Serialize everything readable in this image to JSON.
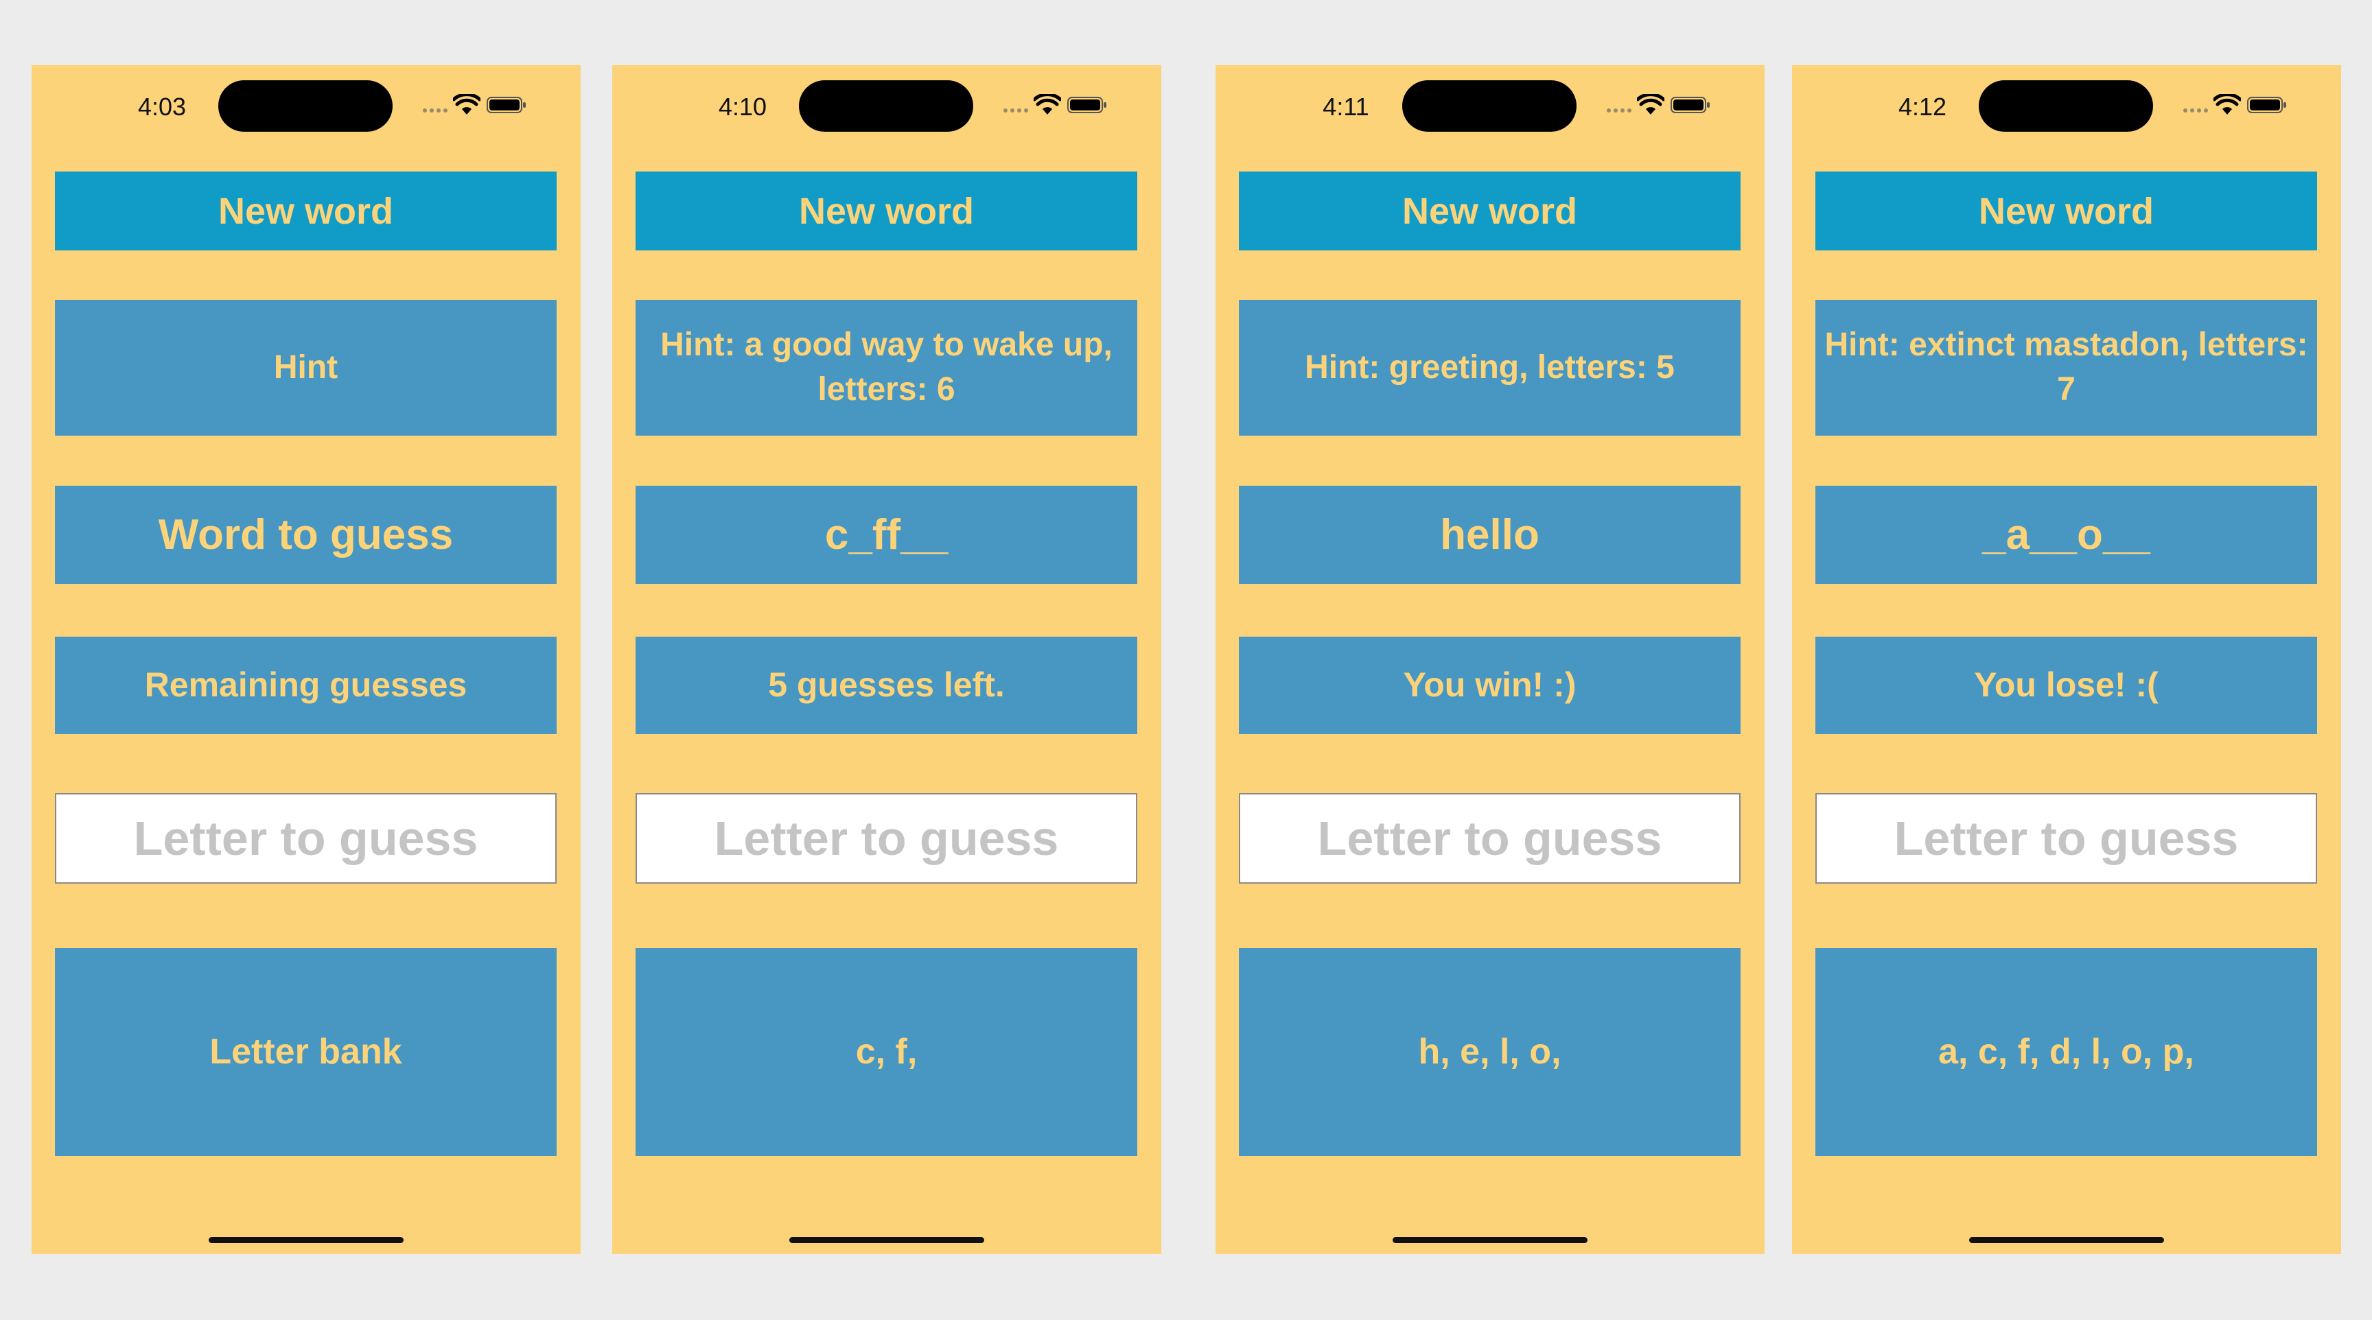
{
  "colors": {
    "background": "#ececec",
    "phone_background": "#fdd37a",
    "new_word_button": "#119cc7",
    "panel": "#4797c2",
    "panel_text": "#fdd37a",
    "input_placeholder": "#c4c4c4"
  },
  "icons": {
    "signal": "cellular-signal-icon",
    "wifi": "wifi-icon",
    "battery": "battery-icon"
  },
  "screens": [
    {
      "status_time": "4:03",
      "new_word_label": "New word",
      "hint": "Hint",
      "word": "Word to guess",
      "remaining": "Remaining guesses",
      "input_placeholder": "Letter to guess",
      "input_value": "",
      "letter_bank": "Letter bank"
    },
    {
      "status_time": "4:10",
      "new_word_label": "New word",
      "hint": "Hint: a good way to wake up, letters: 6",
      "word": "c_ff__",
      "remaining": "5 guesses left.",
      "input_placeholder": "Letter to guess",
      "input_value": "",
      "letter_bank": "c, f,"
    },
    {
      "status_time": "4:11",
      "new_word_label": "New word",
      "hint": "Hint: greeting, letters: 5",
      "word": "hello",
      "remaining": "You win! :)",
      "input_placeholder": "Letter to guess",
      "input_value": "",
      "letter_bank": "h, e, l, o,"
    },
    {
      "status_time": "4:12",
      "new_word_label": "New word",
      "hint": "Hint: extinct mastadon, letters: 7",
      "word": "_a__o__",
      "remaining": "You lose! :(",
      "input_placeholder": "Letter to guess",
      "input_value": "",
      "letter_bank": "a, c, f, d, l, o, p,"
    }
  ]
}
